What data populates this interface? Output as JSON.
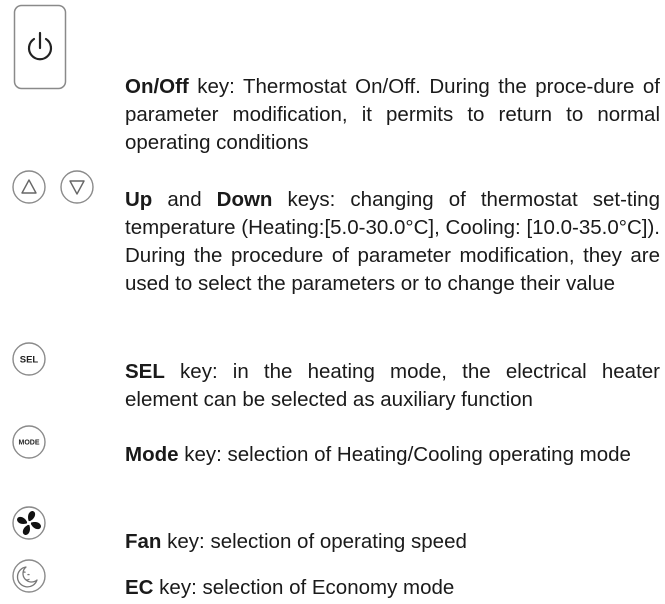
{
  "keys": [
    {
      "icon": "power-icon",
      "name": "On/Off",
      "text": " key: Thermostat On/Off.  During the proce-dure of parameter modification, it permits to return to normal operating conditions"
    },
    {
      "icon": "up-arrow-icon",
      "icon2": "down-arrow-icon",
      "name": "Up",
      "mid": " and ",
      "name2": "Down",
      "text": " keys: changing of thermostat set-ting temperature (Heating:[5.0-30.0°C], Cooling: [10.0-35.0°C]).  During the procedure of parameter modification, they are used to select the parameters or to change their value"
    },
    {
      "icon": "sel-icon",
      "icon_label": "SEL",
      "name": "SEL",
      "text": " key: in the heating mode, the electrical heater element can be selected as auxiliary function"
    },
    {
      "icon": "mode-icon",
      "icon_label": "MODE",
      "name": "Mode",
      "text": " key: selection of Heating/Cooling operating mode"
    },
    {
      "icon": "fan-icon",
      "name": "Fan",
      "text": " key: selection of operating speed"
    },
    {
      "icon": "moon-icon",
      "name": "EC",
      "text": " key: selection of Economy mode"
    }
  ]
}
